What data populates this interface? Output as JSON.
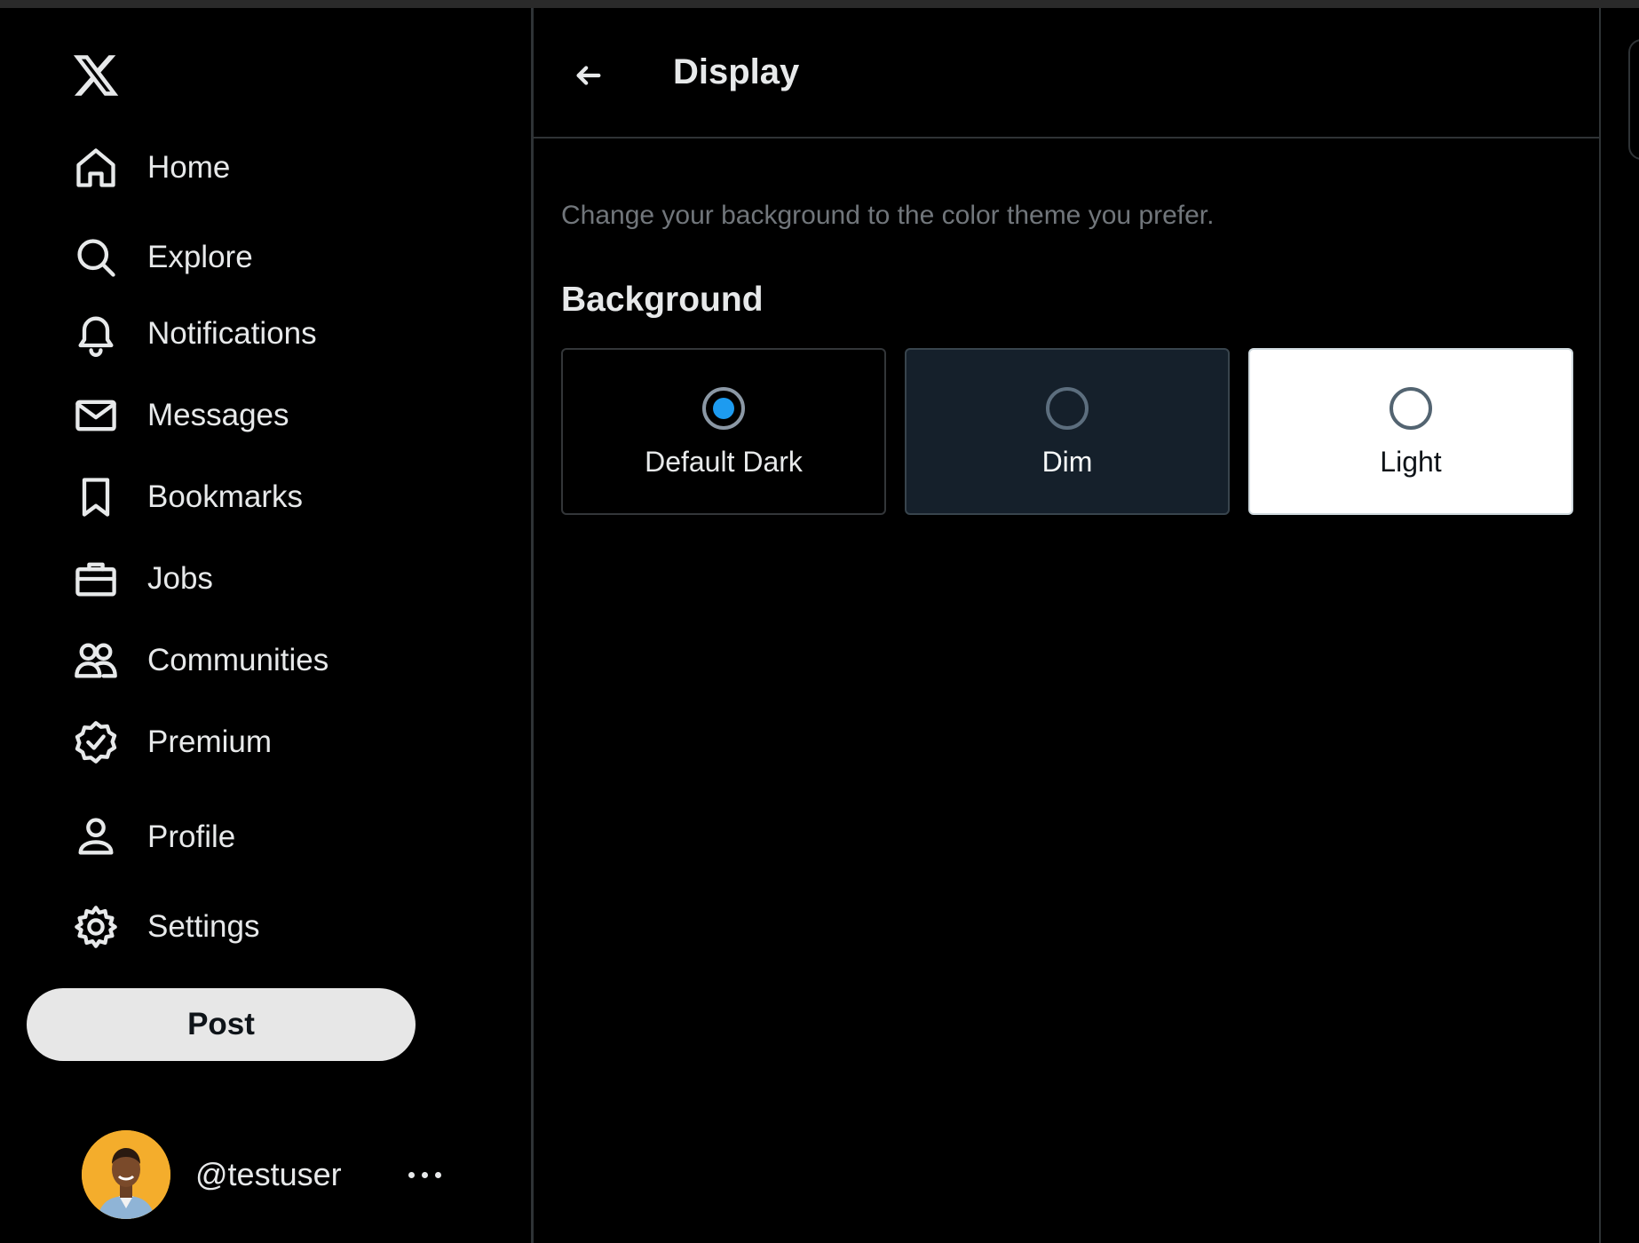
{
  "app": {
    "logo": "x-logo"
  },
  "sidebar": {
    "items": [
      {
        "label": "Home",
        "icon": "home-icon"
      },
      {
        "label": "Explore",
        "icon": "search-icon"
      },
      {
        "label": "Notifications",
        "icon": "bell-icon"
      },
      {
        "label": "Messages",
        "icon": "envelope-icon"
      },
      {
        "label": "Bookmarks",
        "icon": "bookmark-icon"
      },
      {
        "label": "Jobs",
        "icon": "briefcase-icon"
      },
      {
        "label": "Communities",
        "icon": "people-icon"
      },
      {
        "label": "Premium",
        "icon": "verified-badge-icon"
      },
      {
        "label": "Profile",
        "icon": "person-icon"
      },
      {
        "label": "Settings",
        "icon": "gear-icon"
      }
    ],
    "post_label": "Post",
    "account": {
      "handle": "@testuser",
      "more_icon": "more-horizontal-icon"
    }
  },
  "main": {
    "title": "Display",
    "back_icon": "arrow-left-icon",
    "description": "Change your background to the color theme you prefer.",
    "section_title": "Background",
    "options": [
      {
        "label": "Default Dark",
        "selected": true,
        "bg": "#000000"
      },
      {
        "label": "Dim",
        "selected": false,
        "bg": "#15202b"
      },
      {
        "label": "Light",
        "selected": false,
        "bg": "#ffffff"
      }
    ]
  },
  "colors": {
    "accent": "#1d9bf0",
    "text": "#e7e9ea",
    "muted": "#71767b"
  }
}
